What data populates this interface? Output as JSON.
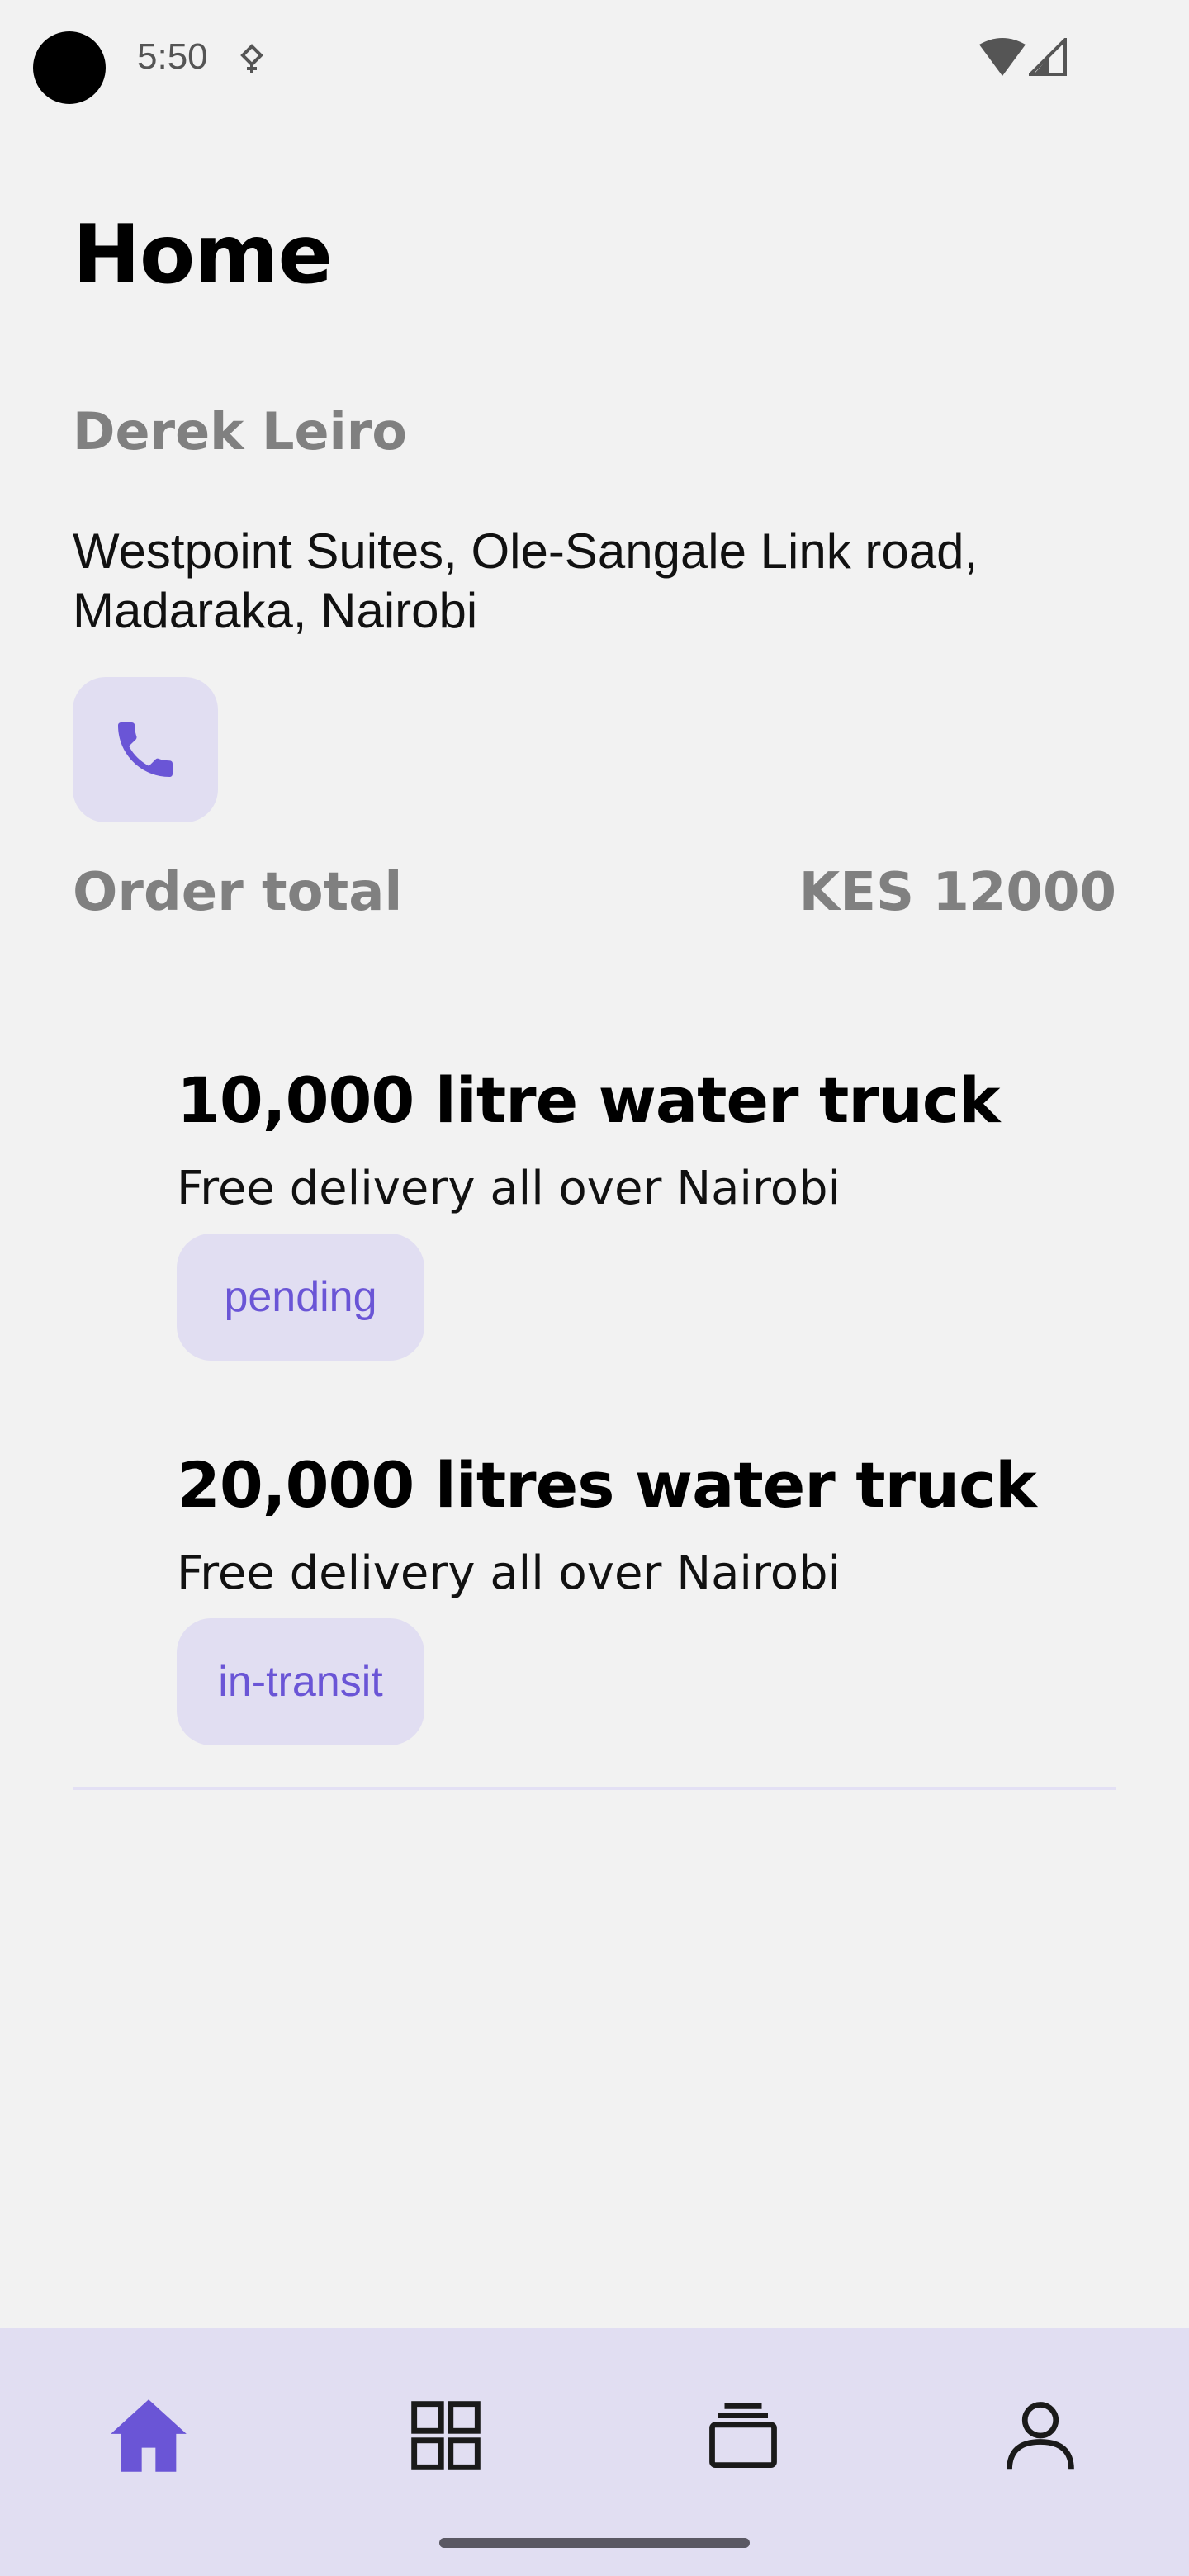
{
  "status_bar": {
    "time": "5:50"
  },
  "header": {
    "title": "Home"
  },
  "customer": {
    "name": "Derek Leiro",
    "address": "Westpoint Suites, Ole-Sangale Link road, Madaraka, Nairobi"
  },
  "order": {
    "total_label": "Order total",
    "total_value": "KES 12000",
    "items": [
      {
        "title": "10,000 litre water truck",
        "description": "Free delivery all over Nairobi",
        "status": "pending"
      },
      {
        "title": "20,000 litres water truck",
        "description": "Free delivery all over Nairobi",
        "status": "in-transit"
      }
    ]
  },
  "bottom_nav": {
    "items": [
      {
        "icon": "home-icon",
        "active": true
      },
      {
        "icon": "grid-icon",
        "active": false
      },
      {
        "icon": "orders-icon",
        "active": false
      },
      {
        "icon": "profile-icon",
        "active": false
      }
    ]
  },
  "colors": {
    "accent": "#6a55d6",
    "chip_background": "#e1def2",
    "nav_background": "#e1def2",
    "background": "#f2f2f2",
    "muted_text": "#808080"
  }
}
